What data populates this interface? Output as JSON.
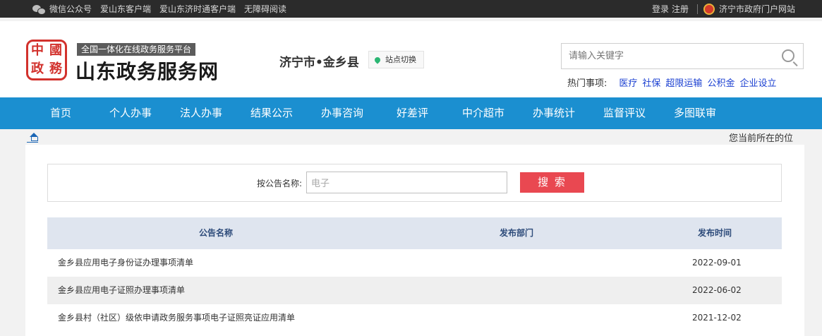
{
  "topbar": {
    "left_links": [
      "微信公众号",
      "爱山东客户端",
      "爱山东济时通客户端",
      "无障碍阅读"
    ],
    "login": "登录",
    "register": "注册",
    "portal": "济宁市政府门户网站"
  },
  "header": {
    "seal_chars": [
      "中",
      "國",
      "政",
      "務"
    ],
    "tagline": "全国一体化在线政务服务平台",
    "site_title": "山东政务服务网",
    "city": "济宁市•金乡县",
    "site_switch": "站点切换",
    "search_placeholder": "请输入关键字",
    "hot_label": "热门事项:",
    "hot_links": [
      "医疗",
      "社保",
      "超限运输",
      "公积金",
      "企业设立"
    ]
  },
  "nav": {
    "items": [
      "首页",
      "个人办事",
      "法人办事",
      "结果公示",
      "办事咨询",
      "好差评",
      "中介超市",
      "办事统计",
      "监督评议",
      "多图联审"
    ]
  },
  "breadcrumb": {
    "location_text": "您当前所在的位"
  },
  "filter": {
    "label": "按公告名称:",
    "input_value": "电子",
    "search_button": "搜 索"
  },
  "table": {
    "headers": [
      "公告名称",
      "发布部门",
      "发布时间"
    ],
    "rows": [
      {
        "name": "金乡县应用电子身份证办理事项清单",
        "dept": "",
        "date": "2022-09-01"
      },
      {
        "name": "金乡县应用电子证照办理事项清单",
        "dept": "",
        "date": "2022-06-02"
      },
      {
        "name": "金乡县村（社区）级依申请政务服务事项电子证照亮证应用清单",
        "dept": "",
        "date": "2021-12-02"
      }
    ]
  }
}
